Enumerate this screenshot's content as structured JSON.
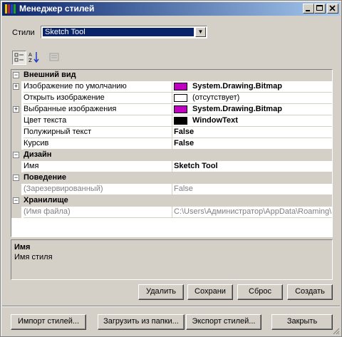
{
  "window": {
    "title": "Менеджер стилей"
  },
  "styles": {
    "label": "Стили",
    "selected": "Sketch Tool"
  },
  "grid": {
    "categories": {
      "appearance": "Внешний вид",
      "design": "Дизайн",
      "behavior": "Поведение",
      "storage": "Хранилище"
    },
    "rows": {
      "default_image": {
        "name": "Изображение по умолчанию",
        "value": "System.Drawing.Bitmap"
      },
      "open_image": {
        "name": "Открыть изображение",
        "value": "(отсутствует)"
      },
      "selected_images": {
        "name": "Выбранные изображения",
        "value": "System.Drawing.Bitmap"
      },
      "text_color": {
        "name": "Цвет текста",
        "value": "WindowText"
      },
      "bold_text": {
        "name": "Полужирный текст",
        "value": "False"
      },
      "italic": {
        "name": "Курсив",
        "value": "False"
      },
      "name": {
        "name": "Имя",
        "value": "Sketch Tool"
      },
      "reserved": {
        "name": "(Зарезервированный)",
        "value": "False"
      },
      "file_name": {
        "name": "(Имя файла)",
        "value": "C:\\Users\\Администратор\\AppData\\Roaming\\"
      }
    },
    "colors": {
      "bitmap_swatch": "#c000c0",
      "text_swatch": "#000000",
      "open_swatch": "#ffffff"
    }
  },
  "help": {
    "title": "Имя",
    "description": "Имя стиля"
  },
  "buttons": {
    "delete": "Удалить",
    "save": "Сохрани",
    "reset": "Сброс",
    "create": "Создать",
    "import": "Импорт стилей...",
    "load_folder": "Загрузить из папки...",
    "export": "Экспорт стилей...",
    "close": "Закрыть"
  }
}
